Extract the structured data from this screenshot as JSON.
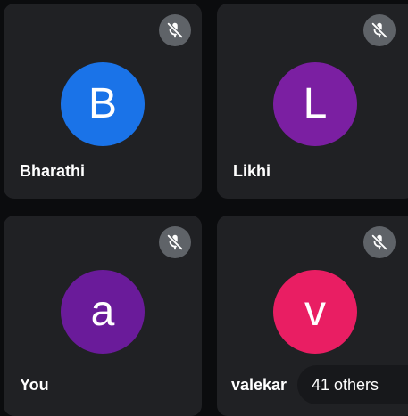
{
  "participants": [
    {
      "name": "Bharathi",
      "initial": "B",
      "avatar_color": "#1a73e8",
      "muted": true,
      "mute_icon": "mic-off-icon"
    },
    {
      "name": "Likhi",
      "initial": "L",
      "avatar_color": "#7b1fa2",
      "muted": true,
      "mute_icon": "mic-off-icon"
    },
    {
      "name": "You",
      "initial": "a",
      "avatar_color": "#6a1b9a",
      "muted": true,
      "mute_icon": "mic-off-icon"
    },
    {
      "name": "valekar",
      "initial": "v",
      "avatar_color": "#e91e63",
      "muted": true,
      "mute_icon": "mic-off-icon"
    }
  ],
  "others_label": "41 others",
  "colors": {
    "tile_background": "#202124",
    "mute_badge": "#5f6368"
  }
}
